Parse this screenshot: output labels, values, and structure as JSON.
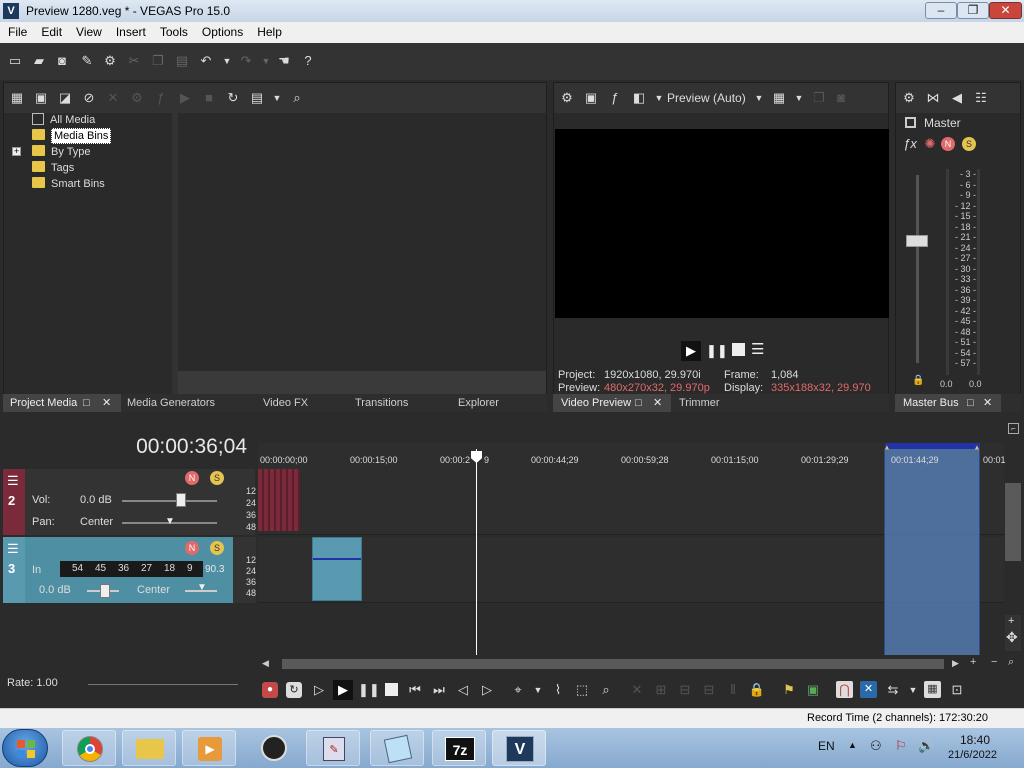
{
  "window": {
    "title": "Preview 1280.veg * - VEGAS Pro 15.0",
    "minimize": "–",
    "maximize": "❐",
    "close": "✕"
  },
  "menu": [
    "File",
    "Edit",
    "View",
    "Insert",
    "Tools",
    "Options",
    "Help"
  ],
  "project_media": {
    "tree": [
      "All Media",
      "Media Bins",
      "By Type",
      "Tags",
      "Smart Bins"
    ],
    "selected": "Media Bins",
    "tabs": [
      "Project Media",
      "Media Generators",
      "Video FX",
      "Transitions",
      "Explorer"
    ]
  },
  "video_preview": {
    "mode": "Preview (Auto)",
    "project_label": "Project:",
    "project_value": "1920x1080, 29.970i",
    "preview_label": "Preview:",
    "preview_value": "480x270x32, 29.970p",
    "frame_label": "Frame:",
    "frame_value": "1,084",
    "display_label": "Display:",
    "display_value": "335x188x32, 29.970",
    "tabs": [
      "Video Preview",
      "Trimmer"
    ]
  },
  "master_bus": {
    "title": "Master",
    "scale": [
      "3",
      "6",
      "9",
      "12",
      "15",
      "18",
      "21",
      "24",
      "27",
      "30",
      "33",
      "36",
      "39",
      "42",
      "45",
      "48",
      "51",
      "54",
      "57"
    ],
    "left_level": "0.0",
    "right_level": "0.0",
    "tab": "Master Bus"
  },
  "timeline": {
    "timecode": "00:00:36;04",
    "ruler": [
      "00:00:00;00",
      "00:00:15;00",
      "00:00:2",
      "9",
      "00:00:44;29",
      "00:00:59;28",
      "00:01:15;00",
      "00:01:29;29",
      "00:01:44;29",
      "00:01"
    ],
    "db_scale": [
      "12",
      "24",
      "36",
      "48"
    ],
    "tracks": [
      {
        "number": "2",
        "vol_label": "Vol:",
        "vol_value": "0.0 dB",
        "pan_label": "Pan:",
        "pan_value": "Center"
      },
      {
        "number": "3",
        "in_label": "In",
        "meter": [
          "54",
          "45",
          "36",
          "27",
          "18",
          "9"
        ],
        "meter_value": "90.3",
        "vol_value": "0.0 dB",
        "pan_value": "Center"
      }
    ],
    "rate": "Rate: 1.00",
    "record_time": "Record Time (2 channels): 172:30:20"
  },
  "taskbar": {
    "lang": "EN",
    "time": "18:40",
    "date": "21/6/2022",
    "apps": [
      "chrome",
      "explorer",
      "media",
      "obs",
      "editor",
      "notepad",
      "7z",
      "vegas"
    ]
  },
  "colors": {
    "accent": "#4f8fa3",
    "track_video": "#7a2a3a",
    "track_audio": "#5a9ab0",
    "clip_blue": "#5a86c0",
    "playhead": "#ffffff"
  }
}
